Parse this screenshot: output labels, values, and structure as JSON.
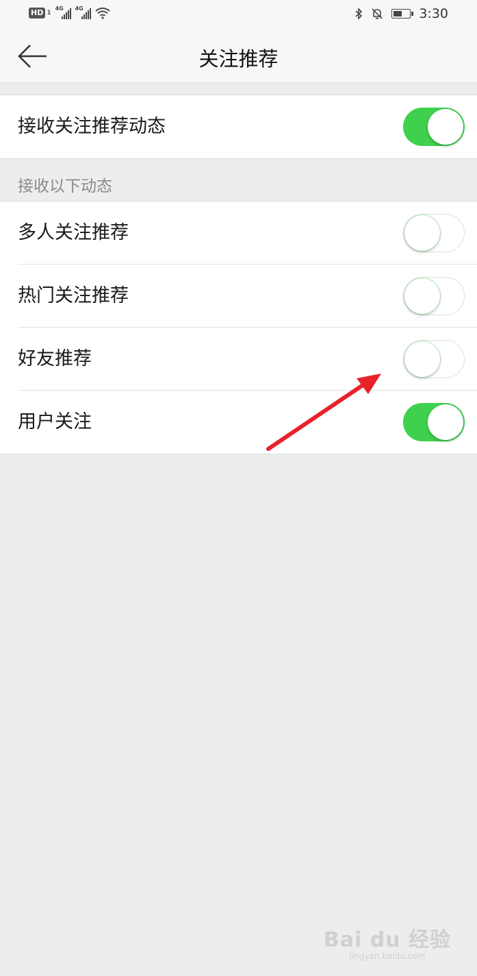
{
  "status_bar": {
    "hd_label": "HD",
    "sim_label": "1",
    "network_1": "4G",
    "network_2": "4G",
    "time": "3:30",
    "icons": [
      "wifi-icon",
      "bluetooth-icon",
      "bell-off-icon",
      "battery-charging-icon"
    ]
  },
  "nav": {
    "title": "关注推荐",
    "back_icon": "arrow-left-icon"
  },
  "main_setting": {
    "label": "接收关注推荐动态",
    "enabled": true
  },
  "section": {
    "header": "接收以下动态",
    "items": [
      {
        "label": "多人关注推荐",
        "enabled": false
      },
      {
        "label": "热门关注推荐",
        "enabled": false
      },
      {
        "label": "好友推荐",
        "enabled": false
      },
      {
        "label": "用户关注",
        "enabled": true
      }
    ]
  },
  "annotation": {
    "type": "red-arrow",
    "color": "#e8222b",
    "points_to": "好友推荐 toggle"
  },
  "watermark": {
    "line1": "Bai du 经验",
    "line2": "jingyan.baidu.com"
  },
  "colors": {
    "toggle_on": "#3fd14e",
    "background": "#ededed",
    "card": "#ffffff"
  }
}
